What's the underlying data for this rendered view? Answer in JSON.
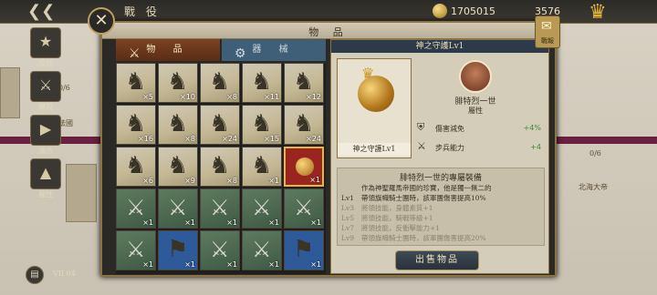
{
  "topbar": {
    "back_icon": "back-arrow-icon",
    "title": "戰 役",
    "gold": "1705015",
    "partial_value": "3576"
  },
  "left_menu": [
    {
      "label": "成就",
      "icon": "trophy-icon"
    },
    {
      "label": "擊殺",
      "icon": "swords-icon"
    },
    {
      "label": "演示",
      "icon": "film-icon"
    },
    {
      "label": "屬性",
      "icon": "rank-icon"
    }
  ],
  "map": {
    "left_fraction": "0/6",
    "left_place": "法國",
    "right_fraction": "0/6",
    "right_place": "北海大帝"
  },
  "window": {
    "title": "物 品",
    "close_icon": "close-icon",
    "badge_label": "戰報"
  },
  "tabs": [
    {
      "label": "物 品",
      "icon": "crossed-swords-icon",
      "active": true
    },
    {
      "label": "器 械",
      "icon": "catapult-icon",
      "active": false
    }
  ],
  "grid": [
    {
      "kind": "unit",
      "count": "×5"
    },
    {
      "kind": "unit",
      "count": "×10"
    },
    {
      "kind": "unit",
      "count": "×8"
    },
    {
      "kind": "unit",
      "count": "×11"
    },
    {
      "kind": "unit",
      "count": "×12"
    },
    {
      "kind": "unit",
      "count": "×16"
    },
    {
      "kind": "unit",
      "count": "×8"
    },
    {
      "kind": "unit",
      "count": "×24"
    },
    {
      "kind": "unit",
      "count": "×15"
    },
    {
      "kind": "unit",
      "count": "×24"
    },
    {
      "kind": "unit",
      "count": "×6"
    },
    {
      "kind": "unit",
      "count": "×9"
    },
    {
      "kind": "unit",
      "count": "×8"
    },
    {
      "kind": "unit",
      "count": "×1"
    },
    {
      "kind": "special",
      "count": "×1"
    },
    {
      "kind": "weapon",
      "count": "×1"
    },
    {
      "kind": "weapon",
      "count": "×1"
    },
    {
      "kind": "weapon",
      "count": "×1"
    },
    {
      "kind": "weapon",
      "count": "×1"
    },
    {
      "kind": "weapon",
      "count": "×1"
    },
    {
      "kind": "weapon",
      "count": "×1"
    },
    {
      "kind": "blue",
      "count": "×1"
    },
    {
      "kind": "weapon",
      "count": "×1"
    },
    {
      "kind": "weapon",
      "count": "×1"
    },
    {
      "kind": "blue",
      "count": "×1"
    }
  ],
  "detail": {
    "header": "神之守護Lv1",
    "item_name": "神之守護Lv1",
    "hero_name": "腓特烈一世",
    "attr_heading": "屬性",
    "attrs": [
      {
        "name": "傷害減免",
        "value": "+4%",
        "icon": "shield-icon"
      },
      {
        "name": "步兵能力",
        "value": "+4",
        "icon": "crossed-swords-icon"
      }
    ],
    "desc_title": "腓特烈一世的專屬裝備",
    "desc_lines": [
      {
        "lvl": "",
        "text": "作為神聖羅馬帝國的珍寶，他是獨一無二的",
        "dim": false
      },
      {
        "lvl": "Lv1",
        "text": "帶領旗幟騎士團時，該軍團傷害提高10%",
        "dim": false
      },
      {
        "lvl": "Lv3",
        "text": "將領技能，身體素質+1",
        "dim": true
      },
      {
        "lvl": "Lv5",
        "text": "將領技能，騎戰等級+1",
        "dim": true
      },
      {
        "lvl": "Lv7",
        "text": "將領技能，反衝擊能力+1",
        "dim": true
      },
      {
        "lvl": "Lv9",
        "text": "帶領旗幟騎士團時，該軍團傷害提高20%",
        "dim": true
      }
    ],
    "sell_label": "出售物品"
  },
  "bottom": {
    "chapter_icon": "chapter-icon",
    "chapter_label": "VII",
    "chapter_number": "04"
  }
}
